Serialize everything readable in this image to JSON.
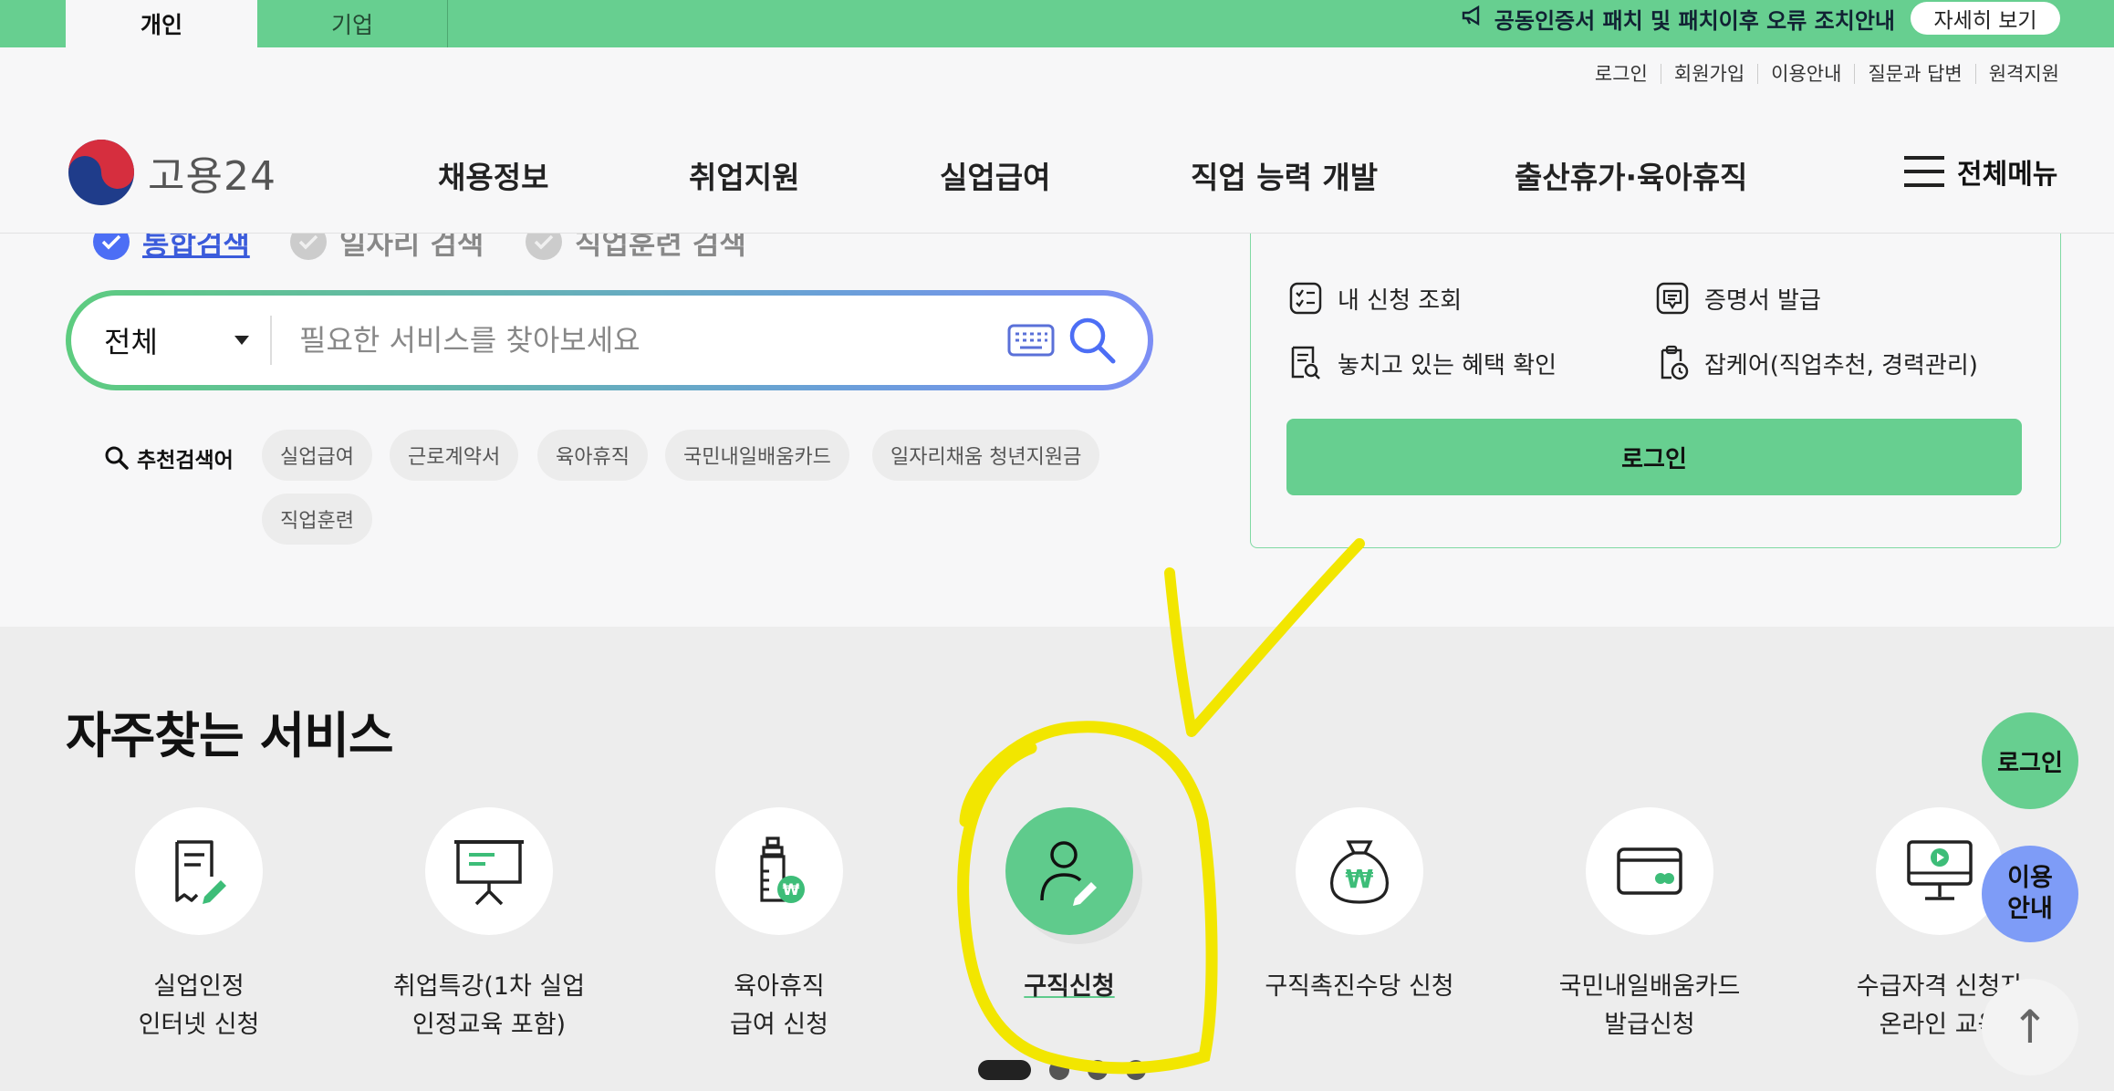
{
  "topbar": {
    "tabs": [
      "개인",
      "기업"
    ],
    "notice": "공동인증서 패치 및 패치이후 오류 조치안내",
    "detail_button": "자세히 보기"
  },
  "util_links": [
    "로그인",
    "회원가입",
    "이용안내",
    "질문과 답변",
    "원격지원"
  ],
  "header": {
    "logo_text": "고용24",
    "nav": [
      "채용정보",
      "취업지원",
      "실업급여",
      "직업 능력 개발",
      "출산휴가·육아휴직"
    ],
    "all_menu": "전체메뉴"
  },
  "search": {
    "scopes": [
      "통합검색",
      "일자리 검색",
      "직업훈련 검색"
    ],
    "select_value": "전체",
    "placeholder": "필요한 서비스를 찾아보세요",
    "recommend_label": "추천검색어",
    "keywords": [
      "실업급여",
      "근로계약서",
      "육아휴직",
      "국민내일배움카드",
      "일자리채움 청년지원금",
      "직업훈련"
    ]
  },
  "login_panel": {
    "items": [
      "내 신청 조회",
      "증명서 발급",
      "놓치고 있는 혜택 확인",
      "잡케어(직업추천, 경력관리)"
    ],
    "login_button": "로그인"
  },
  "services": {
    "title": "자주찾는 서비스",
    "items": [
      {
        "label": "실업인정\n인터넷 신청",
        "icon": "document-pen-icon"
      },
      {
        "label": "취업특강(1차 실업\n인정교육 포함)",
        "icon": "presentation-board-icon"
      },
      {
        "label": "육아휴직\n급여 신청",
        "icon": "baby-bottle-icon"
      },
      {
        "label": "구직신청",
        "icon": "person-pen-icon"
      },
      {
        "label": "구직촉진수당 신청",
        "icon": "money-bag-icon"
      },
      {
        "label": "국민내일배움카드\n발급신청",
        "icon": "card-icon"
      },
      {
        "label": "수급자격 신청자\n온라인 교육",
        "icon": "monitor-play-icon"
      }
    ]
  },
  "floating": {
    "login": "로그인",
    "guide": "이용\n안내",
    "top": "↑"
  },
  "colors": {
    "brand_green": "#67cf90",
    "accent_blue": "#7e9cf7",
    "annotation_yellow": "#f2e600"
  }
}
